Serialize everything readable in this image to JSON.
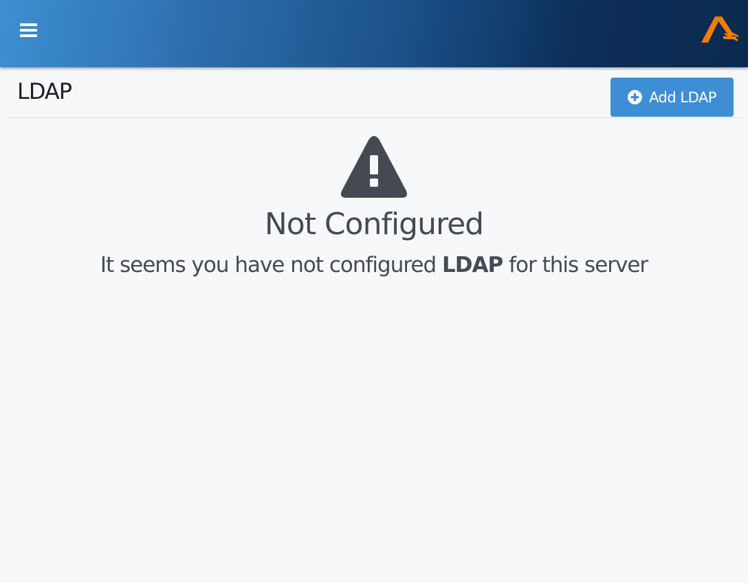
{
  "topbar": {
    "menu_icon": "hamburger-menu-icon",
    "logo_icon": "brand-logo-icon",
    "gradient_start": "#3d8fd3",
    "gradient_end": "#0a2a50",
    "logo_color": "#f57c00"
  },
  "page": {
    "title": "LDAP",
    "add_button_label": "Add LDAP",
    "add_button_icon": "plus-circle-icon",
    "button_color": "#3e8ed6"
  },
  "empty_state": {
    "icon": "warning-triangle-icon",
    "title": "Not Configured",
    "message_prefix": "It seems you have not configured ",
    "message_highlight": "LDAP",
    "message_suffix": " for this server",
    "text_color": "#454a52"
  }
}
